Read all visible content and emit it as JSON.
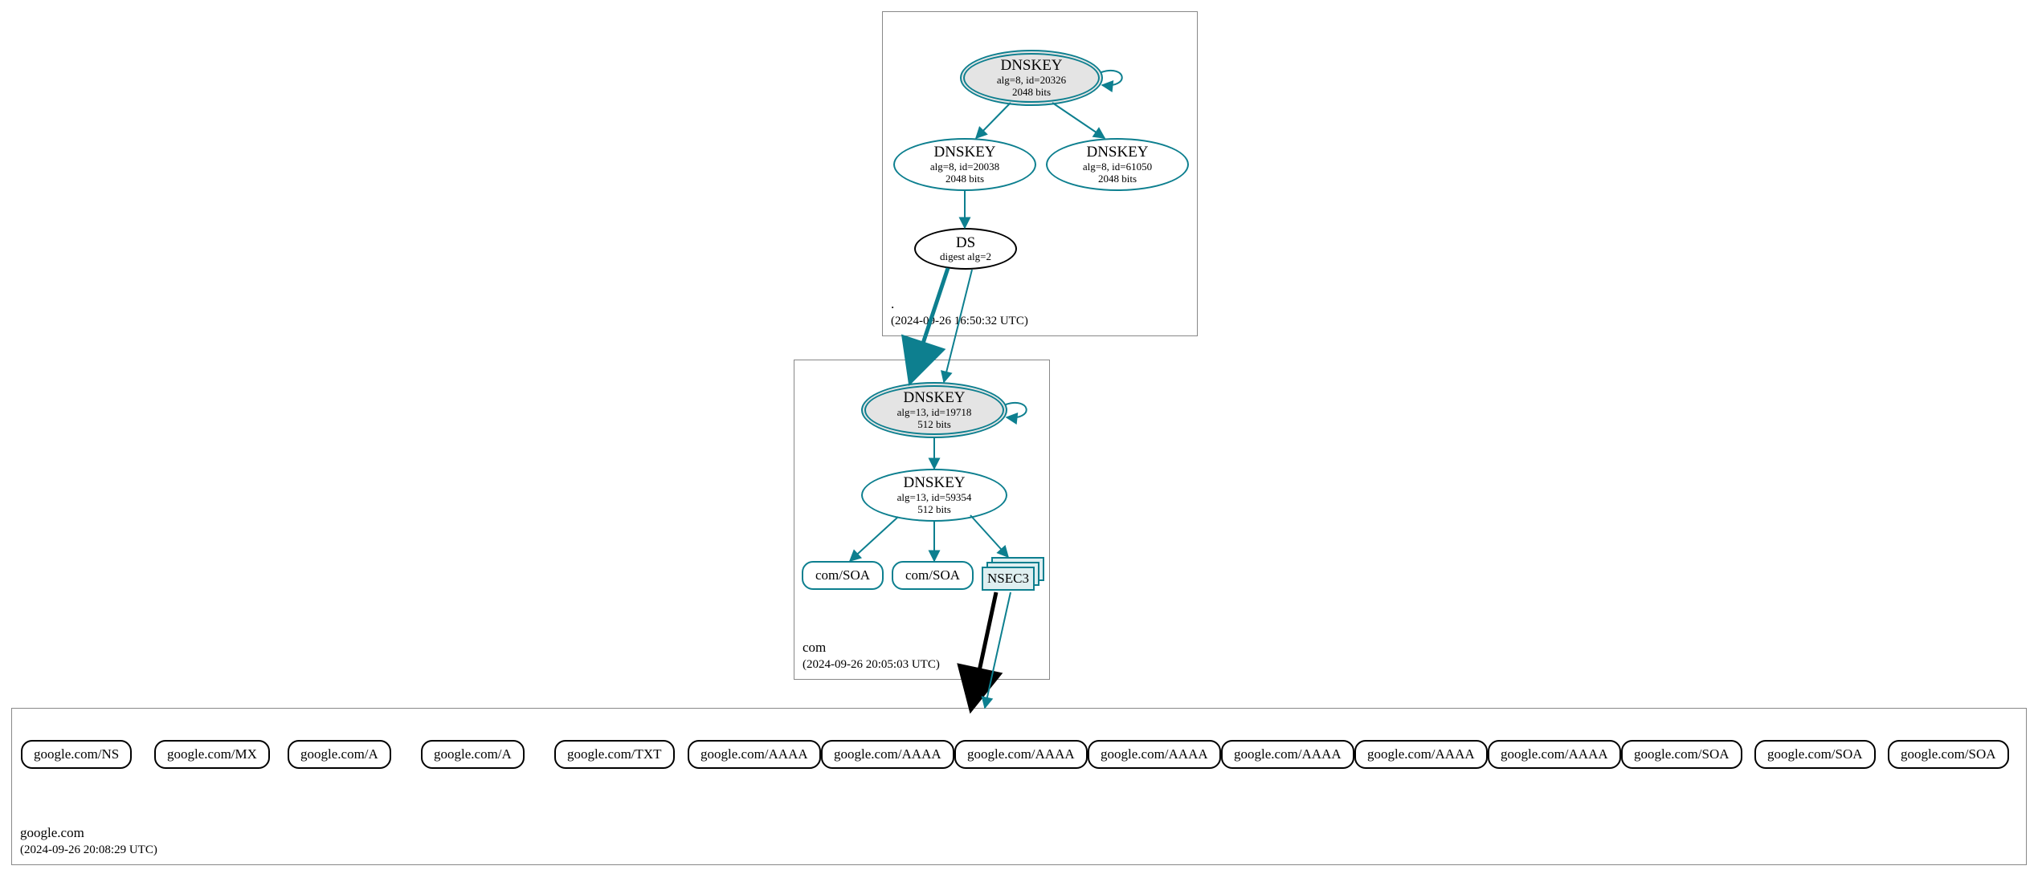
{
  "zones": {
    "root": {
      "name": ".",
      "timestamp": "(2024-09-26 16:50:32 UTC)"
    },
    "com": {
      "name": "com",
      "timestamp": "(2024-09-26 20:05:03 UTC)"
    },
    "google": {
      "name": "google.com",
      "timestamp": "(2024-09-26 20:08:29 UTC)"
    }
  },
  "nodes": {
    "root_ksk": {
      "title": "DNSKEY",
      "line1": "alg=8, id=20326",
      "line2": "2048 bits"
    },
    "root_zsk1": {
      "title": "DNSKEY",
      "line1": "alg=8, id=20038",
      "line2": "2048 bits"
    },
    "root_zsk2": {
      "title": "DNSKEY",
      "line1": "alg=8, id=61050",
      "line2": "2048 bits"
    },
    "root_ds": {
      "title": "DS",
      "line1": "digest alg=2"
    },
    "com_ksk": {
      "title": "DNSKEY",
      "line1": "alg=13, id=19718",
      "line2": "512 bits"
    },
    "com_zsk": {
      "title": "DNSKEY",
      "line1": "alg=13, id=59354",
      "line2": "512 bits"
    },
    "com_soa1": {
      "label": "com/SOA"
    },
    "com_soa2": {
      "label": "com/SOA"
    },
    "nsec3": {
      "label": "NSEC3"
    }
  },
  "rrsets": [
    "google.com/NS",
    "google.com/MX",
    "google.com/A",
    "google.com/A",
    "google.com/TXT",
    "google.com/AAAA",
    "google.com/AAAA",
    "google.com/AAAA",
    "google.com/AAAA",
    "google.com/AAAA",
    "google.com/AAAA",
    "google.com/AAAA",
    "google.com/SOA",
    "google.com/SOA",
    "google.com/SOA"
  ]
}
